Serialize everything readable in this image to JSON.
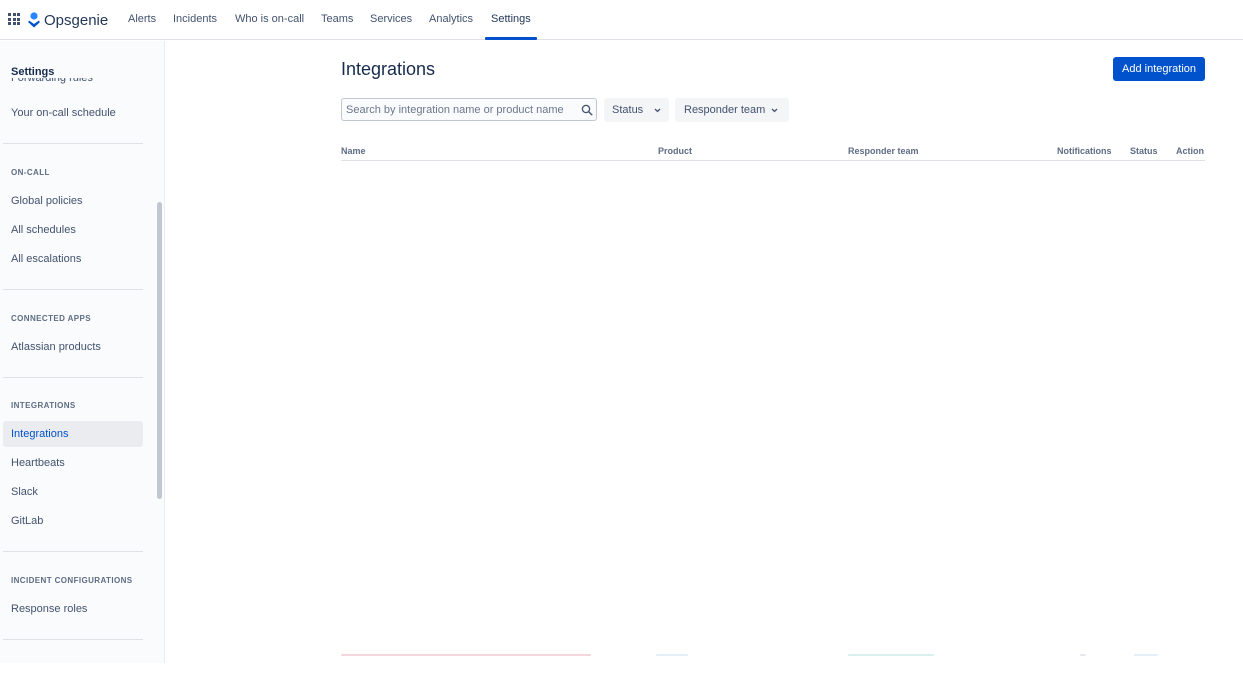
{
  "topnav": {
    "brand": "Opsgenie",
    "items": [
      {
        "label": "Alerts"
      },
      {
        "label": "Incidents"
      },
      {
        "label": "Who is on-call"
      },
      {
        "label": "Teams"
      },
      {
        "label": "Services"
      },
      {
        "label": "Analytics"
      },
      {
        "label": "Settings"
      }
    ],
    "active": "Settings",
    "accent": "#0052cc"
  },
  "sidebar": {
    "title": "Settings",
    "partial_item": "Forwarding rules",
    "items": [
      {
        "label": "Your on-call schedule"
      },
      {
        "label": "Global policies"
      },
      {
        "label": "All schedules"
      },
      {
        "label": "All escalations"
      },
      {
        "label": "Atlassian products"
      },
      {
        "label": "Integrations"
      },
      {
        "label": "Heartbeats"
      },
      {
        "label": "Slack"
      },
      {
        "label": "GitLab"
      },
      {
        "label": "Response roles"
      }
    ],
    "sections": [
      {
        "heading": "ON-CALL"
      },
      {
        "heading": "CONNECTED APPS"
      },
      {
        "heading": "INTEGRATIONS"
      },
      {
        "heading": "INCIDENT CONFIGURATIONS"
      }
    ],
    "active_item": "Integrations"
  },
  "main": {
    "title": "Integrations",
    "add_button": "Add integration",
    "search": {
      "placeholder": "Search by integration name or product name",
      "value": ""
    },
    "filters": [
      {
        "label": "Status"
      },
      {
        "label": "Responder team"
      }
    ],
    "columns": [
      "Name",
      "Product",
      "Responder team",
      "Notifications",
      "Status",
      "Action"
    ]
  },
  "icons": {
    "app_switcher": "grid-icon",
    "logo": "opsgenie-logo-icon",
    "search": "search-icon",
    "chevron": "chevron-down-icon"
  }
}
